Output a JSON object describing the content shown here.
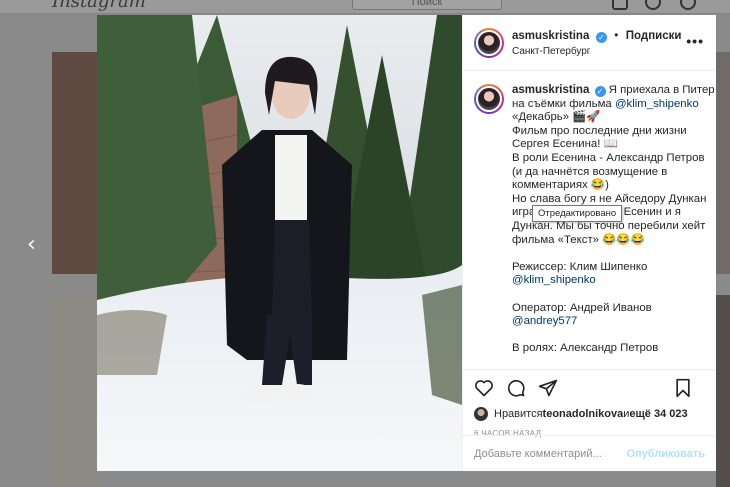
{
  "background": {
    "logo": "Instagram",
    "search_label": "Поиск",
    "prev_arrow": "‹"
  },
  "post": {
    "username": "asmuskristina",
    "verified_mark": "✓",
    "dot": "•",
    "follow_label": "Подписки",
    "location": "Санкт-Петербург",
    "more_label": "•••",
    "caption_lines": [
      {
        "text": "Я приехала в Питер"
      },
      {
        "pre": "на съёмки фильма ",
        "mention": "@klim_shipenko"
      },
      {
        "text": "«Декабрь» 🎬🚀"
      },
      {
        "text": "Фильм про последние дни жизни"
      },
      {
        "text": "Сергея Есенина! 📖"
      },
      {
        "text": "В роли Есенина - Александр Петров"
      },
      {
        "text": "(и да начнётся возмущение в"
      },
      {
        "text": "комментариях 😂)"
      },
      {
        "text": "Но слава богу я не Айседору Дункан"
      },
      {
        "text": "играю. А то Петров - Есенин и я"
      },
      {
        "text": "Дункан. Мы бы точно перебили хейт"
      },
      {
        "text": "фильма «Текст» 😂😂😂"
      },
      {
        "text": ""
      },
      {
        "text": "Режиссер: Клим Шипенко"
      },
      {
        "mention": "@klim_shipenko"
      },
      {
        "text": ""
      },
      {
        "text": "Оператор: Андрей Иванов"
      },
      {
        "mention": "@andrey577"
      },
      {
        "text": ""
      },
      {
        "text": "В ролях: Александр Петров"
      }
    ],
    "tooltip": "Отредактировано",
    "likes_prefix": "Нравится ",
    "likes_user": "teonadolnikova",
    "likes_suffix": " и ",
    "likes_count": "ещё 34 023",
    "time_ago": "6 ЧАСОВ НАЗАД",
    "comment_placeholder": "Добавьте комментарий...",
    "publish_label": "Опубликовать"
  },
  "icons": [
    "heart-icon",
    "comment-icon",
    "share-icon",
    "bookmark-icon",
    "verified-icon",
    "more-icon",
    "chevron-left-icon"
  ],
  "colors": {
    "verified": "#3897f0",
    "publish_disabled": "#b2dffc",
    "text": "#262626",
    "muted": "#8e8e8e"
  }
}
